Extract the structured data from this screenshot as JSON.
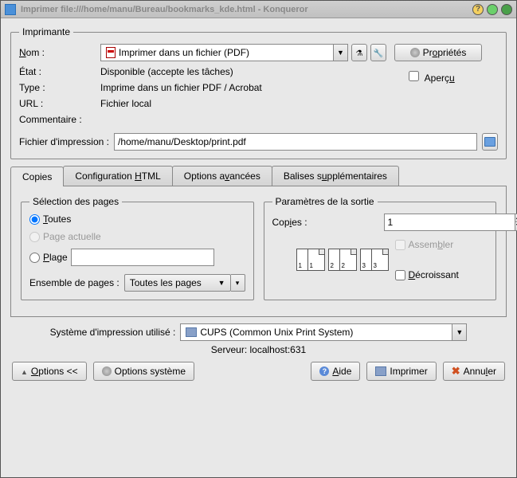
{
  "window": {
    "title": "Imprimer file:///home/manu/Bureau/bookmarks_kde.html - Konqueror"
  },
  "printer_group": {
    "legend": "Imprimante",
    "name_label": "Nom :",
    "name_value": "Imprimer dans un fichier (PDF)",
    "state_label": "État :",
    "state_value": "Disponible (accepte les tâches)",
    "type_label": "Type :",
    "type_value": "Imprime dans un fichier PDF / Acrobat",
    "url_label": "URL :",
    "url_value": "Fichier local",
    "comment_label": "Commentaire :",
    "properties_btn": "Propriétés",
    "preview_label": "Aperçu",
    "file_label": "Fichier d'impression :",
    "file_value": "/home/manu/Desktop/print.pdf"
  },
  "tabs": {
    "copies": "Copies",
    "html": "Configuration HTML",
    "advanced": "Options avancées",
    "extra": "Balises supplémentaires"
  },
  "page_select": {
    "legend": "Sélection des pages",
    "all": "Toutes",
    "current": "Page actuelle",
    "range": "Plage",
    "ensemble_label": "Ensemble de pages :",
    "ensemble_value": "Toutes les pages"
  },
  "output": {
    "legend": "Paramètres de la sortie",
    "copies_label": "Copies :",
    "copies_value": "1",
    "collate_label": "Assembler",
    "reverse_label": "Décroissant"
  },
  "system": {
    "label": "Système d'impression utilisé :",
    "value": "CUPS (Common Unix Print System)",
    "server_label": "Serveur: localhost:631"
  },
  "footer": {
    "options": "Options <<",
    "sys_options": "Options système",
    "help": "Aide",
    "print": "Imprimer",
    "cancel": "Annuler"
  }
}
